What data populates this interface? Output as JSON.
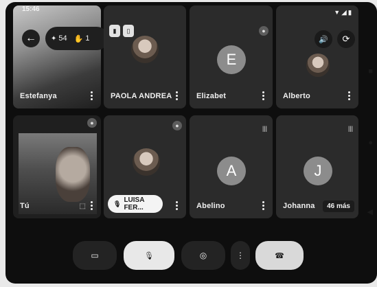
{
  "status_bar": {
    "time": "15:46",
    "right_icons": "▼ ◢ ▮"
  },
  "overlay": {
    "hand_count": "54",
    "people_count": "1"
  },
  "participants": [
    {
      "name": "Estefanya",
      "type": "video"
    },
    {
      "name": "PAOLA ANDREA",
      "type": "photo"
    },
    {
      "name": "Elizabet",
      "type": "letter",
      "initial": "E"
    },
    {
      "name": "Alberto",
      "type": "photo"
    },
    {
      "name": "Tú",
      "type": "video-self"
    },
    {
      "name": "LUISA FER...",
      "type": "photo-pill"
    },
    {
      "name": "Abelino",
      "type": "letter",
      "initial": "A"
    },
    {
      "name": "Johanna",
      "type": "letter",
      "initial": "J",
      "more_badge": "46 más"
    }
  ],
  "colors": {
    "hangup_bg": "#d9d9d9",
    "mic_bg": "#e8e8e8",
    "tile_bg": "#2b2b2b",
    "avatar_bg": "#8c8c8c"
  },
  "icons": {
    "back": "←",
    "camera": "▭",
    "mic_off": "🎙",
    "effects": "◎",
    "more": "⋮",
    "hangup": "☎",
    "speaker": "🔊",
    "switch_camera": "⟳",
    "nav_back": "◀",
    "nav_home": "●",
    "nav_recent": "■"
  }
}
